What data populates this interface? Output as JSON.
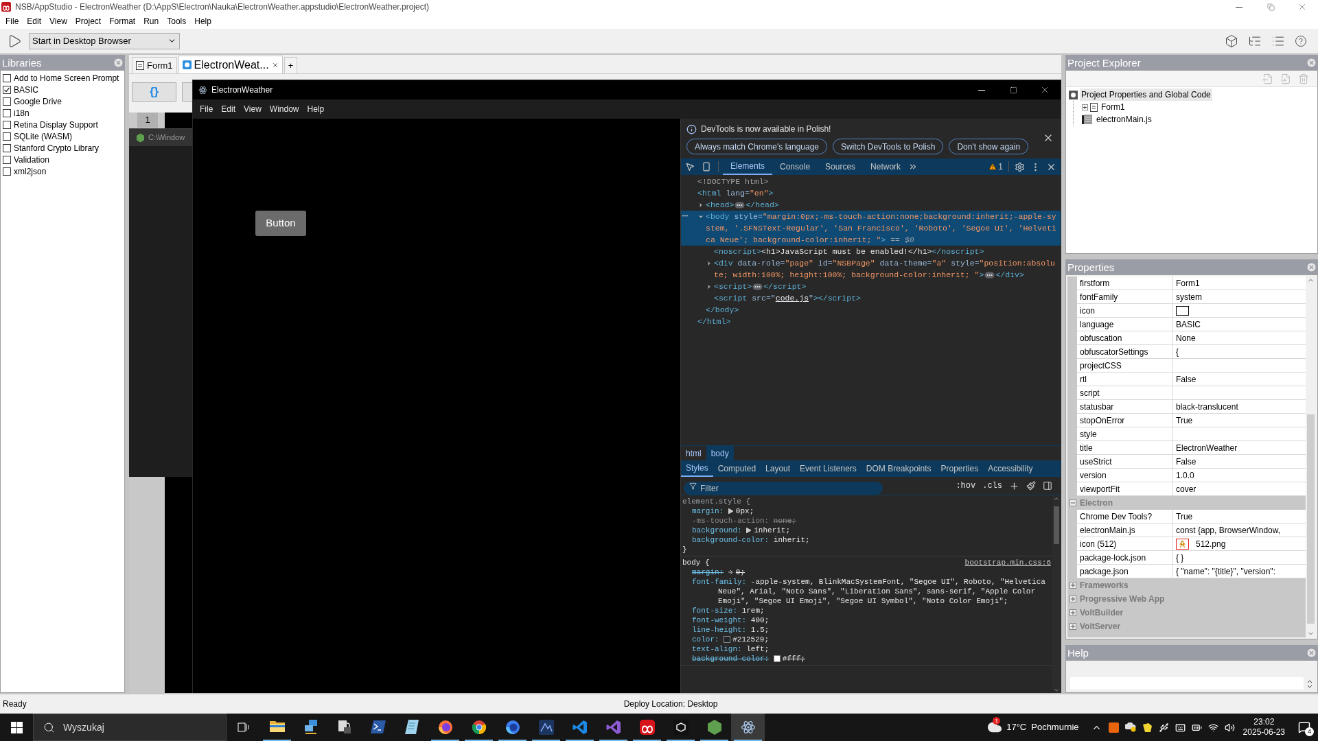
{
  "window": {
    "title": "NSB/AppStudio - ElectronWeather (D:\\AppS\\Electron\\Nauka\\ElectronWeather.appstudio\\ElectronWeather.project)"
  },
  "menu": [
    "File",
    "Edit",
    "View",
    "Project",
    "Format",
    "Run",
    "Tools",
    "Help"
  ],
  "toolbar": {
    "run_target": "Start in Desktop Browser"
  },
  "libraries": {
    "title": "Libraries",
    "items": [
      {
        "label": "Add to Home Screen Prompt",
        "checked": false
      },
      {
        "label": "BASIC",
        "checked": true
      },
      {
        "label": "Google Drive",
        "checked": false
      },
      {
        "label": "i18n",
        "checked": false
      },
      {
        "label": "Retina Display Support",
        "checked": false
      },
      {
        "label": "SQLite (WASM)",
        "checked": false
      },
      {
        "label": "Stanford Crypto Library",
        "checked": false
      },
      {
        "label": "Validation",
        "checked": false
      },
      {
        "label": "xml2json",
        "checked": false
      }
    ]
  },
  "editor_tabs": [
    {
      "label": "Form1",
      "kind": "form",
      "selected": false
    },
    {
      "label": "ElectronWeat...",
      "kind": "code",
      "selected": true
    },
    {
      "label": "+",
      "kind": "add",
      "selected": false
    }
  ],
  "editor": {
    "format_button": "{}",
    "line_numbers": [
      "1"
    ]
  },
  "console_window": {
    "title": "C:\\Window"
  },
  "app_window": {
    "title": "ElectronWeather",
    "menu": [
      "File",
      "Edit",
      "View",
      "Window",
      "Help"
    ],
    "page_button": "Button"
  },
  "devtools": {
    "banner": {
      "message": "DevTools is now available in Polish!",
      "buttons": [
        "Always match Chrome's language",
        "Switch DevTools to Polish",
        "Don't show again"
      ]
    },
    "tabs": [
      {
        "label": "Elements",
        "selected": true
      },
      {
        "label": "Console",
        "selected": false
      },
      {
        "label": "Sources",
        "selected": false
      },
      {
        "label": "Network",
        "selected": false
      }
    ],
    "warnings": "1",
    "dom": [
      {
        "kind": "leaf",
        "selected": false,
        "segs": [
          {
            "kind": "doctype",
            "text": "<!DOCTYPE html>"
          }
        ]
      },
      {
        "kind": "open",
        "selected": false,
        "segs": [
          {
            "kind": "tag",
            "text": "<html"
          },
          {
            "kind": "attr",
            "text": " lang="
          },
          {
            "kind": "value",
            "text": "\"en\""
          },
          {
            "kind": "tag",
            "text": ">"
          }
        ],
        "close": "</html>",
        "children": [
          {
            "kind": "collapsed",
            "selected": false,
            "segs": [
              {
                "kind": "tag",
                "text": "<head>"
              },
              {
                "kind": "more"
              },
              {
                "kind": "tag",
                "text": "</head>"
              }
            ]
          },
          {
            "kind": "expanded",
            "selected": true,
            "segs": [
              {
                "kind": "tag",
                "text": "<body"
              },
              {
                "kind": "attr",
                "text": " style="
              },
              {
                "kind": "value",
                "text": "\"margin:0px;-ms-touch-action:none;background:inherit;-apple-system, '.SFNSText-Regular', 'San Francisco', 'Roboto', 'Segoe UI', 'Helvetica Neue'; background-color:inherit; \""
              },
              {
                "kind": "tag",
                "text": ">"
              },
              {
                "kind": "hint",
                "text": " == $0"
              }
            ],
            "close": "</body>",
            "children": [
              {
                "kind": "leaf",
                "selected": false,
                "segs": [
                  {
                    "kind": "tag",
                    "text": "<noscript>"
                  },
                  {
                    "kind": "text",
                    "text": "<h1>JavaScript must be enabled!</h1>"
                  },
                  {
                    "kind": "tag",
                    "text": "</noscript>"
                  }
                ]
              },
              {
                "kind": "collapsed",
                "selected": false,
                "segs": [
                  {
                    "kind": "tag",
                    "text": "<div"
                  },
                  {
                    "kind": "attr",
                    "text": " data-role="
                  },
                  {
                    "kind": "value",
                    "text": "\"page\""
                  },
                  {
                    "kind": "attr",
                    "text": " id="
                  },
                  {
                    "kind": "value",
                    "text": "\"NSBPage\""
                  },
                  {
                    "kind": "attr",
                    "text": " data-theme="
                  },
                  {
                    "kind": "value",
                    "text": "\"a\""
                  },
                  {
                    "kind": "attr",
                    "text": " style="
                  },
                  {
                    "kind": "value",
                    "text": "\"position:absolute; width:100%; height:100%; background-color:inherit; \""
                  },
                  {
                    "kind": "tag",
                    "text": ">"
                  },
                  {
                    "kind": "more"
                  },
                  {
                    "kind": "tag",
                    "text": "</div>"
                  }
                ]
              },
              {
                "kind": "collapsed",
                "selected": false,
                "segs": [
                  {
                    "kind": "tag",
                    "text": "<script>"
                  },
                  {
                    "kind": "more"
                  },
                  {
                    "kind": "tag",
                    "text": "</script>"
                  }
                ]
              },
              {
                "kind": "leaf",
                "selected": false,
                "segs": [
                  {
                    "kind": "tag",
                    "text": "<script"
                  },
                  {
                    "kind": "attr",
                    "text": " src=\""
                  },
                  {
                    "kind": "link",
                    "text": "code.js"
                  },
                  {
                    "kind": "attr",
                    "text": "\""
                  },
                  {
                    "kind": "tag",
                    "text": "></script>"
                  }
                ]
              }
            ]
          }
        ]
      }
    ],
    "breadcrumbs": [
      {
        "label": "html",
        "selected": false
      },
      {
        "label": "body",
        "selected": true
      }
    ],
    "pane_tabs": [
      {
        "label": "Styles",
        "selected": true
      },
      {
        "label": "Computed",
        "selected": false
      },
      {
        "label": "Layout",
        "selected": false
      },
      {
        "label": "Event Listeners",
        "selected": false
      },
      {
        "label": "DOM Breakpoints",
        "selected": false
      },
      {
        "label": "Properties",
        "selected": false
      },
      {
        "label": "Accessibility",
        "selected": false
      }
    ],
    "filter": {
      "placeholder": "Filter"
    },
    "style_toggles": [
      ":hov",
      ".cls"
    ],
    "rules": [
      {
        "selector": "element.style {",
        "close": "}",
        "declarations": [
          {
            "name": "margin:",
            "value": "0px;",
            "kind": "active",
            "expandable": true,
            "swatch": false
          },
          {
            "name": "-ms-touch-action:",
            "value": "none;",
            "kind": "invalid",
            "expandable": false,
            "swatch": false
          },
          {
            "name": "background:",
            "value": "inherit;",
            "kind": "active",
            "expandable": true,
            "swatch": false
          },
          {
            "name": "background-color:",
            "value": "inherit;",
            "kind": "active",
            "expandable": false,
            "swatch": false
          }
        ]
      },
      {
        "selector": "body {",
        "source": "bootstrap.min.css:6",
        "declarations": [
          {
            "name": "margin:",
            "value": "0;",
            "kind": "overridden",
            "expandable": true,
            "swatch": false
          },
          {
            "name": "font-family:",
            "value": "-apple-system, BlinkMacSystemFont, \"Segoe UI\", Roboto, \"Helvetica Neue\", Arial, \"Noto Sans\", \"Liberation Sans\", sans-serif, \"Apple Color Emoji\", \"Segoe UI Emoji\", \"Segoe UI Symbol\", \"Noto Color Emoji\";",
            "kind": "active",
            "expandable": false,
            "swatch": false
          },
          {
            "name": "font-size:",
            "value": "1rem;",
            "kind": "active",
            "expandable": false,
            "swatch": false
          },
          {
            "name": "font-weight:",
            "value": "400;",
            "kind": "active",
            "expandable": false,
            "swatch": false
          },
          {
            "name": "line-height:",
            "value": "1.5;",
            "kind": "active",
            "expandable": false,
            "swatch": false
          },
          {
            "name": "color:",
            "value": "#212529;",
            "kind": "active",
            "expandable": false,
            "swatch": true,
            "color": "#212529"
          },
          {
            "name": "text-align:",
            "value": "left;",
            "kind": "active",
            "expandable": false,
            "swatch": false
          },
          {
            "name": "background-color:",
            "value": "#fff;",
            "kind": "overridden",
            "expandable": false,
            "swatch": true,
            "color": "#ffffff"
          }
        ]
      }
    ]
  },
  "project_explorer": {
    "title": "Project Explorer",
    "tree": [
      {
        "label": "Project Properties and Global Code",
        "kind": "project",
        "selected": true,
        "children": [
          {
            "label": "Form1",
            "kind": "form",
            "selected": false,
            "expanded": false
          },
          {
            "label": "electronMain.js",
            "kind": "script",
            "selected": false
          }
        ]
      }
    ]
  },
  "properties": {
    "title": "Properties",
    "rows": [
      {
        "kind": "property",
        "name": "firstform",
        "value": "Form1"
      },
      {
        "kind": "property",
        "name": "fontFamily",
        "value": "system"
      },
      {
        "kind": "swatch",
        "name": "icon"
      },
      {
        "kind": "property",
        "name": "language",
        "value": "BASIC"
      },
      {
        "kind": "property",
        "name": "obfuscation",
        "value": "None"
      },
      {
        "kind": "property",
        "name": "obfuscatorSettings",
        "value": "{"
      },
      {
        "kind": "property",
        "name": "projectCSS"
      },
      {
        "kind": "property",
        "name": "rtl",
        "value": "False"
      },
      {
        "kind": "property",
        "name": "script"
      },
      {
        "kind": "property",
        "name": "statusbar",
        "value": "black-translucent"
      },
      {
        "kind": "property",
        "name": "stopOnError",
        "value": "True"
      },
      {
        "kind": "property",
        "name": "style"
      },
      {
        "kind": "property",
        "name": "title",
        "value": "ElectronWeather"
      },
      {
        "kind": "property",
        "name": "useStrict",
        "value": "False"
      },
      {
        "kind": "property",
        "name": "version",
        "value": "1.0.0"
      },
      {
        "kind": "property",
        "name": "viewportFit",
        "value": "cover"
      },
      {
        "kind": "group",
        "name": "Electron",
        "expanded": true
      },
      {
        "kind": "property",
        "name": "Chrome Dev Tools?",
        "value": "True"
      },
      {
        "kind": "property",
        "name": "electronMain.js",
        "value": "const {app, BrowserWindow,"
      },
      {
        "kind": "image",
        "name": "icon (512)",
        "value": "512.png"
      },
      {
        "kind": "property",
        "name": "package-lock.json",
        "value": "{ }"
      },
      {
        "kind": "property",
        "name": "package.json",
        "value": "{ \"name\": \"{title}\", \"version\":"
      },
      {
        "kind": "group",
        "name": "Frameworks",
        "expanded": false
      },
      {
        "kind": "group",
        "name": "Progressive Web App",
        "expanded": false
      },
      {
        "kind": "group",
        "name": "VoltBuilder",
        "expanded": false
      },
      {
        "kind": "group",
        "name": "VoltServer",
        "expanded": false
      }
    ]
  },
  "help": {
    "title": "Help"
  },
  "status_bar": {
    "left": "Ready",
    "center": "Deploy Location: Desktop"
  },
  "taskbar": {
    "search": "Wyszukaj",
    "apps": [
      {
        "running": true,
        "selected": false
      },
      {
        "running": false,
        "selected": false
      },
      {
        "running": false,
        "selected": false
      },
      {
        "running": false,
        "selected": false
      },
      {
        "running": false,
        "selected": false
      },
      {
        "running": true,
        "selected": false
      },
      {
        "running": true,
        "selected": false
      },
      {
        "running": true,
        "selected": false
      },
      {
        "running": true,
        "selected": false
      },
      {
        "running": true,
        "selected": false
      },
      {
        "running": true,
        "selected": false
      },
      {
        "running": true,
        "selected": false
      },
      {
        "running": true,
        "selected": false
      },
      {
        "running": true,
        "selected": false
      },
      {
        "running": true,
        "selected": true
      }
    ],
    "weather_badge": "1",
    "temperature": "17°C",
    "weather": "Pochmurnie",
    "time": "23:02",
    "date": "2025-06-23",
    "notifications": "4"
  }
}
